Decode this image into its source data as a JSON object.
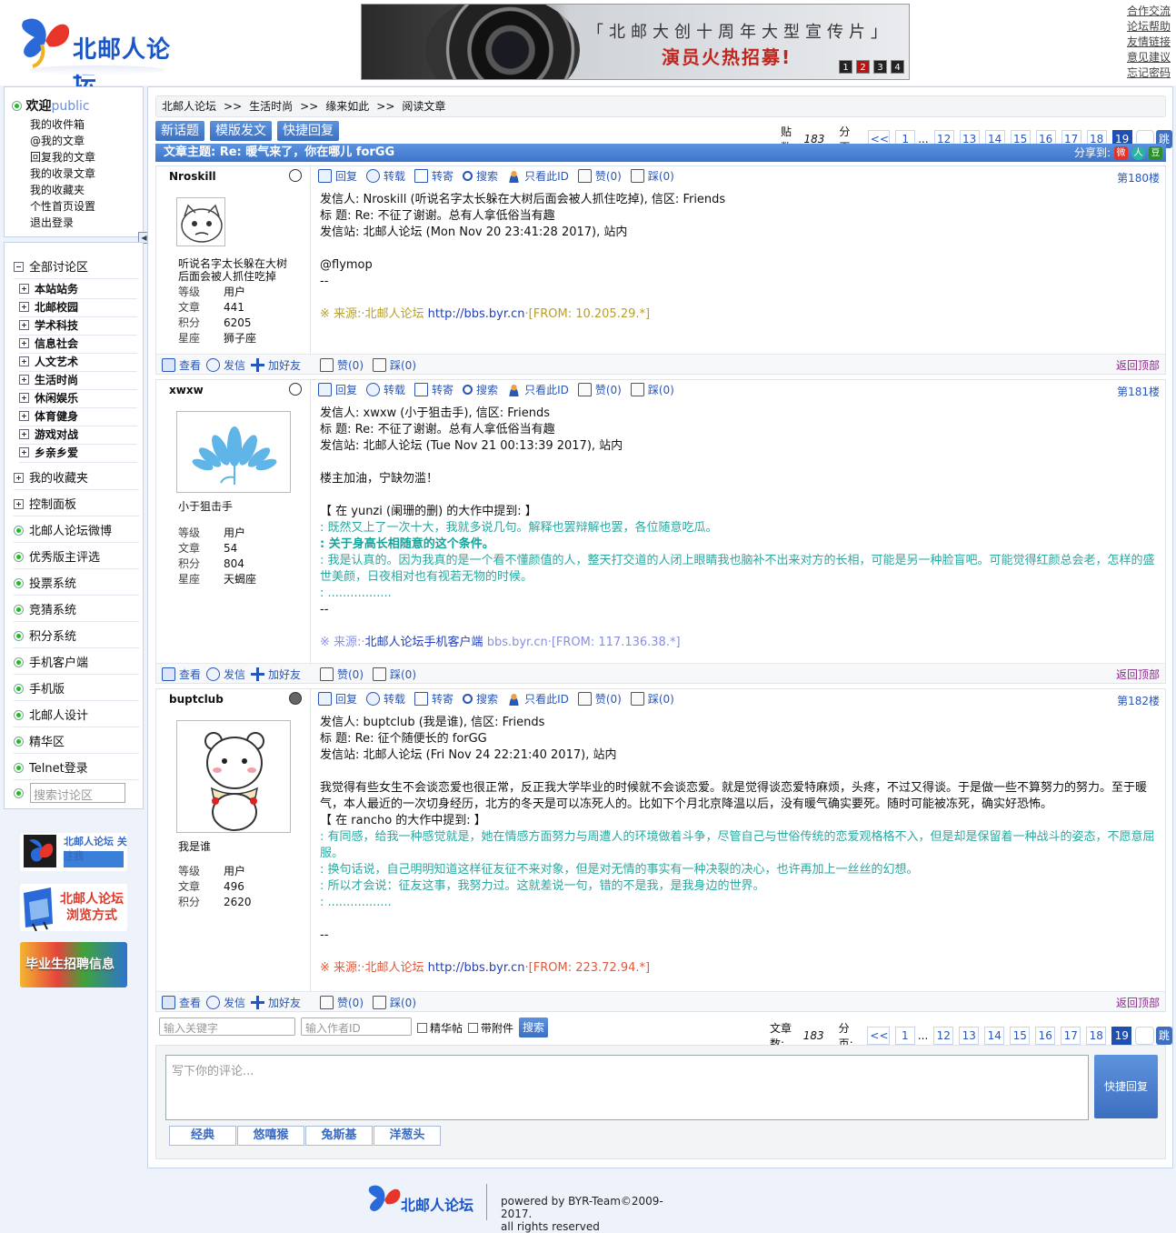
{
  "header": {
    "logo_text": "北邮人论坛",
    "banner": {
      "line1": "「北邮大创十周年大型宣传片」",
      "line2": "演员火热招募!",
      "pages": [
        "1",
        "2",
        "3",
        "4"
      ],
      "active_page": "2"
    },
    "links": [
      "合作交流",
      "论坛帮助",
      "友情链接",
      "意见建议",
      "忘记密码"
    ]
  },
  "userbox": {
    "welcome": "欢迎",
    "username": "public",
    "items": [
      "我的收件箱",
      "@我的文章",
      "回复我的文章",
      "我的收录文章",
      "我的收藏夹",
      "个性首页设置",
      "退出登录"
    ]
  },
  "nav": {
    "all": "全部讨论区",
    "sections": [
      "本站站务",
      "北邮校园",
      "学术科技",
      "信息社会",
      "人文艺术",
      "生活时尚",
      "休闲娱乐",
      "体育健身",
      "游戏对战",
      "乡亲乡爱"
    ],
    "fav": "我的收藏夹",
    "panel": "控制面板",
    "links": [
      "北邮人论坛微博",
      "优秀版主评选",
      "投票系统",
      "竞猜系统",
      "积分系统",
      "手机客户端",
      "手机版",
      "北邮人设计",
      "精华区",
      "Telnet登录"
    ],
    "search_placeholder": "搜索讨论区",
    "promos": [
      "北邮人论坛 关注我",
      "北邮人论坛 浏览方式",
      "毕业生招聘信息"
    ]
  },
  "crumb": {
    "parts": [
      "北邮人论坛",
      ">>",
      "生活时尚",
      ">>",
      "缘来如此",
      ">>",
      "阅读文章"
    ]
  },
  "toolbar": {
    "new": "新话题",
    "template": "模版发文",
    "quick": "快捷回复"
  },
  "pager_top": {
    "label": "贴数:",
    "count": "183",
    "fenye": "分页:",
    "prev": "<<",
    "pages": [
      "1",
      "...",
      "12",
      "13",
      "14",
      "15",
      "16",
      "17",
      "18",
      "19"
    ],
    "current": "19",
    "go": "跳"
  },
  "title": {
    "label": "文章主题:",
    "text": "Re: 暖气来了，你在哪儿 forGG",
    "share": "分享到:"
  },
  "actions": {
    "reply": "回复",
    "forward": "转载",
    "transfer": "转寄",
    "search": "搜索",
    "only": "只看此ID",
    "up": "赞(0)",
    "down": "踩(0)",
    "view": "查看",
    "msg": "发信",
    "friend": "加好友",
    "top": "返回顶部"
  },
  "posts": [
    {
      "user": "Nroskill",
      "floor": "第180楼",
      "nick": "听说名字太长躲在大树后面会被人抓住吃掉",
      "info": [
        [
          "等级",
          "用户"
        ],
        [
          "文章",
          "441"
        ],
        [
          "积分",
          "6205"
        ],
        [
          "星座",
          "狮子座"
        ]
      ],
      "lines": [
        "发信人: Nroskill (听说名字太长躲在大树后面会被人抓住吃掉), 信区: Friends",
        "标  题: Re: 不征了谢谢。总有人拿低俗当有趣",
        "发信站: 北邮人论坛 (Mon Nov 20 23:41:28 2017), 站内",
        "",
        "@flymop",
        "--",
        ""
      ],
      "source": {
        "pre": "※ 来源:·北邮人论坛 ",
        "link": "http://bbs.byr.cn",
        "post": "·[FROM: 10.205.29.*]"
      }
    },
    {
      "user": "xwxw",
      "floor": "第181楼",
      "nick": "小于狙击手",
      "info": [
        [
          "等级",
          "用户"
        ],
        [
          "文章",
          "54"
        ],
        [
          "积分",
          "804"
        ],
        [
          "星座",
          "天蝎座"
        ]
      ],
      "lines": [
        "发信人: xwxw (小于狙击手), 信区: Friends",
        "标  题: Re: 不征了谢谢。总有人拿低俗当有趣",
        "发信站: 北邮人论坛 (Tue Nov 21 00:13:39 2017), 站内",
        "",
        "楼主加油，宁缺勿滥！",
        "",
        "【 在 yunzi (阑珊的删) 的大作中提到: 】"
      ],
      "quotes": [
        ": 既然又上了一次十大，我就多说几句。解释也罢辩解也罢，各位随意吃瓜。",
        ": 关于身高长相随意的这个条件。",
        ": 我是认真的。因为我真的是一个看不懂颜值的人，整天打交道的人闭上眼睛我也脑补不出来对方的长相，可能是另一种脸盲吧。可能觉得红颜总会老，怎样的盛世美颜，日夜相对也有视若无物的时候。",
        ": ................."
      ],
      "tail": "--",
      "source": {
        "pre": "※ 来源:·",
        "link": "北邮人论坛手机客户端",
        "post": " bbs.byr.cn·[FROM: 117.136.38.*]"
      }
    },
    {
      "user": "buptclub",
      "floor": "第182楼",
      "nick": "我是谁",
      "info": [
        [
          "等级",
          "用户"
        ],
        [
          "文章",
          "496"
        ],
        [
          "积分",
          "2620"
        ]
      ],
      "lines": [
        "发信人: buptclub (我是谁), 信区: Friends",
        "标  题: Re: 征个随便长的 forGG",
        "发信站: 北邮人论坛 (Fri Nov 24 22:21:40 2017), 站内",
        "",
        "我觉得有些女生不会谈恋爱也很正常，反正我大学毕业的时候就不会谈恋爱。就是觉得谈恋爱特麻烦，头疼，不过又得谈。于是做一些不算努力的努力。至于暖气，本人最近的一次切身经历，北方的冬天是可以冻死人的。比如下个月北京降温以后，没有暖气确实要死。随时可能被冻死，确实好恐怖。",
        "【 在 rancho 的大作中提到: 】"
      ],
      "quotes": [
        ": 有同感，给我一种感觉就是，她在情感方面努力与周遭人的环境做着斗争，尽管自己与世俗传统的恋爱观格格不入，但是却是保留着一种战斗的姿态，不愿意屈服。",
        ": 换句话说，自己明明知道这样征友征不来对象，但是对无情的事实有一种决裂的决心，也许再加上一丝丝的幻想。",
        ": 所以才会说：征友这事，我努力过。这就差说一句，错的不是我，是我身边的世界。",
        ": ................."
      ],
      "tail": "--",
      "source": {
        "pre": "※ 来源:·北邮人论坛 ",
        "link": "http://bbs.byr.cn",
        "post": "·[FROM: 223.72.94.*]"
      }
    }
  ],
  "bottom": {
    "kw_placeholder": "输入关键字",
    "author_placeholder": "输入作者ID",
    "elite": "精华帖",
    "attach": "带附件",
    "search": "搜索"
  },
  "pager_bottom": {
    "label": "文章数:",
    "count": "183",
    "fenye": "分页:",
    "prev": "<<",
    "pages": [
      "1",
      "...",
      "12",
      "13",
      "14",
      "15",
      "16",
      "17",
      "18",
      "19"
    ],
    "current": "19",
    "go": "跳"
  },
  "reply": {
    "placeholder": "写下你的评论...",
    "button": "快捷回复",
    "tabs": [
      "经典",
      "悠嘻猴",
      "兔斯基",
      "洋葱头"
    ]
  },
  "footer": {
    "logo": "北邮人论坛",
    "line1": "powered by BYR-Team©2009-2017.",
    "line2": "all rights reserved"
  },
  "colors": {
    "accent": "#3f75c9",
    "quote": "#2aa8a0",
    "link": "#2856b6"
  }
}
